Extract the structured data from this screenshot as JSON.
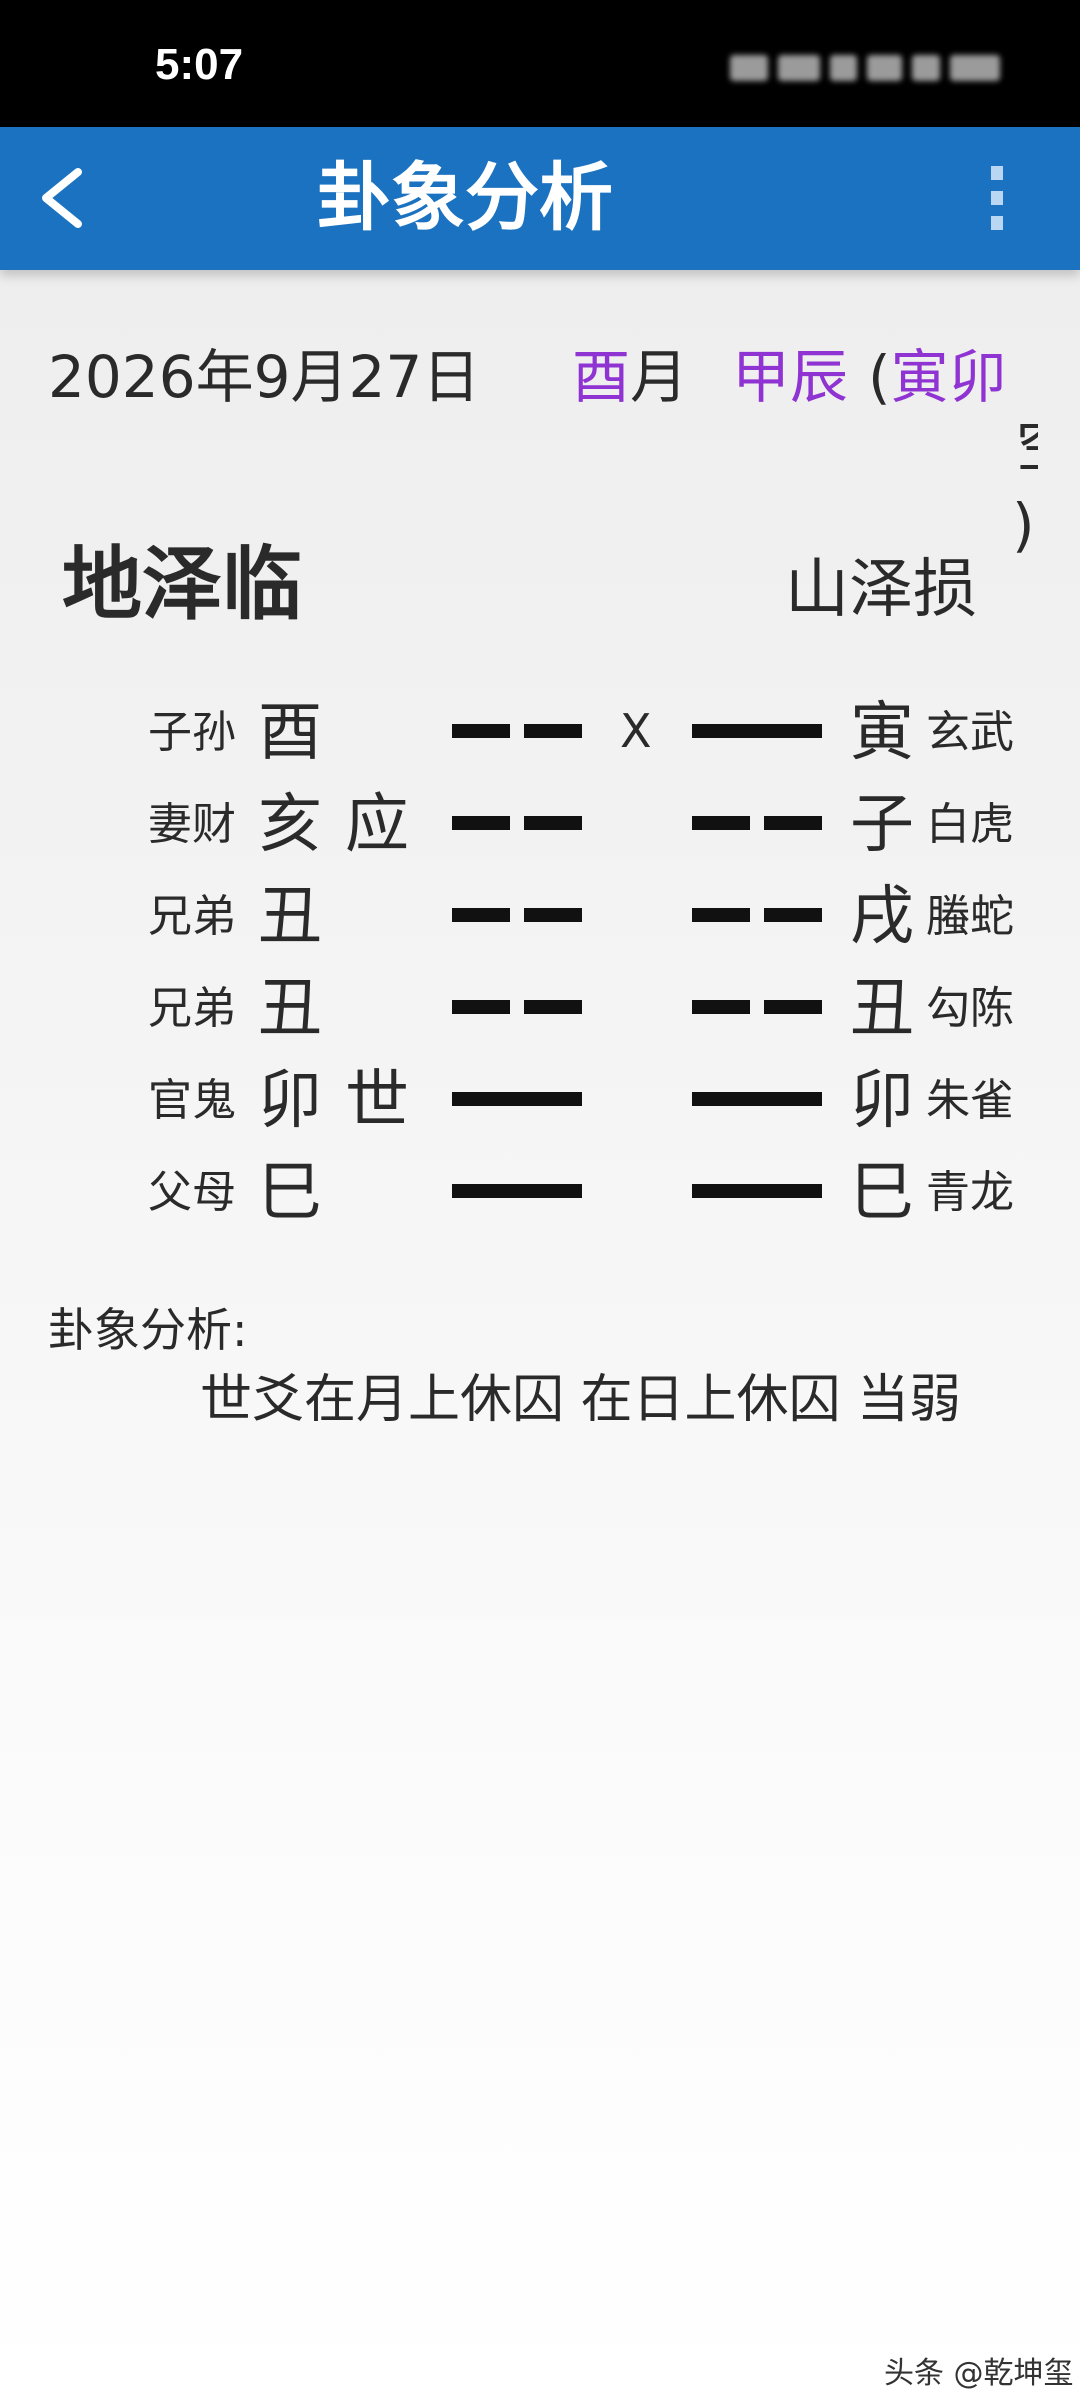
{
  "status_bar": {
    "time": "5:07"
  },
  "app_bar": {
    "title": "卦象分析",
    "back_icon": "chevron-left-icon",
    "menu_icon": "more-vertical-icon"
  },
  "date_info": {
    "date": "2026年9月27日",
    "month_branch": "酉",
    "month_suffix": "月",
    "day_stem_branch": "甲辰",
    "open_paren": "(",
    "xun_kong": "寅卯",
    "overflow_glyph": "空",
    "close_paren": ")"
  },
  "hexagram": {
    "main_name": "地泽临",
    "changed_name": "山泽损",
    "lines": [
      {
        "relation": "子孙",
        "branch": "酉",
        "shiying": "",
        "main_type": "yin",
        "moving_mark": "X",
        "changed_type": "yang",
        "changed_branch": "寅",
        "spirit": "玄武"
      },
      {
        "relation": "妻财",
        "branch": "亥",
        "shiying": "应",
        "main_type": "yin",
        "moving_mark": "",
        "changed_type": "yin",
        "changed_branch": "子",
        "spirit": "白虎"
      },
      {
        "relation": "兄弟",
        "branch": "丑",
        "shiying": "",
        "main_type": "yin",
        "moving_mark": "",
        "changed_type": "yin",
        "changed_branch": "戌",
        "spirit": "螣蛇"
      },
      {
        "relation": "兄弟",
        "branch": "丑",
        "shiying": "",
        "main_type": "yin",
        "moving_mark": "",
        "changed_type": "yin",
        "changed_branch": "丑",
        "spirit": "勾陈"
      },
      {
        "relation": "官鬼",
        "branch": "卯",
        "shiying": "世",
        "main_type": "yang",
        "moving_mark": "",
        "changed_type": "yang",
        "changed_branch": "卯",
        "spirit": "朱雀"
      },
      {
        "relation": "父母",
        "branch": "巳",
        "shiying": "",
        "main_type": "yang",
        "moving_mark": "",
        "changed_type": "yang",
        "changed_branch": "巳",
        "spirit": "青龙"
      }
    ]
  },
  "analysis": {
    "label": "卦象分析:",
    "text": "世爻在月上休囚 在日上休囚 当弱"
  },
  "watermark": "头条 @乾坤玺",
  "colors": {
    "app_bar": "#1a72c0",
    "accent_purple": "#8f34d2",
    "text": "#2a2a2a",
    "status_bar": "#000000"
  }
}
